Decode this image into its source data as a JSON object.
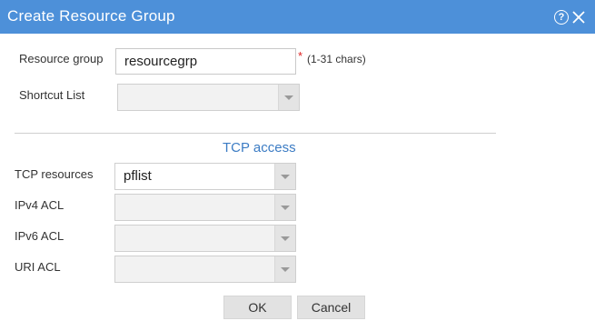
{
  "dialog": {
    "title": "Create Resource Group",
    "help_symbol": "?"
  },
  "form": {
    "resource_group": {
      "label": "Resource group",
      "value": "resourcegrp",
      "required_mark": "*",
      "hint": "(1-31 chars)"
    },
    "shortcut_list": {
      "label": "Shortcut List",
      "value": ""
    }
  },
  "tcp_access": {
    "section_title": "TCP access",
    "tcp_resources": {
      "label": "TCP resources",
      "value": "pflist"
    },
    "ipv4_acl": {
      "label": "IPv4 ACL",
      "value": ""
    },
    "ipv6_acl": {
      "label": "IPv6 ACL",
      "value": ""
    },
    "uri_acl": {
      "label": "URI ACL",
      "value": ""
    }
  },
  "buttons": {
    "ok_label": "OK",
    "cancel_label": "Cancel"
  },
  "colors": {
    "titlebar": "#4d90d9",
    "section_title": "#3c7cc4",
    "required": "#dd2222"
  },
  "icons": {
    "help": "help-icon",
    "close": "close-icon",
    "dropdown": "chevron-down-icon"
  }
}
